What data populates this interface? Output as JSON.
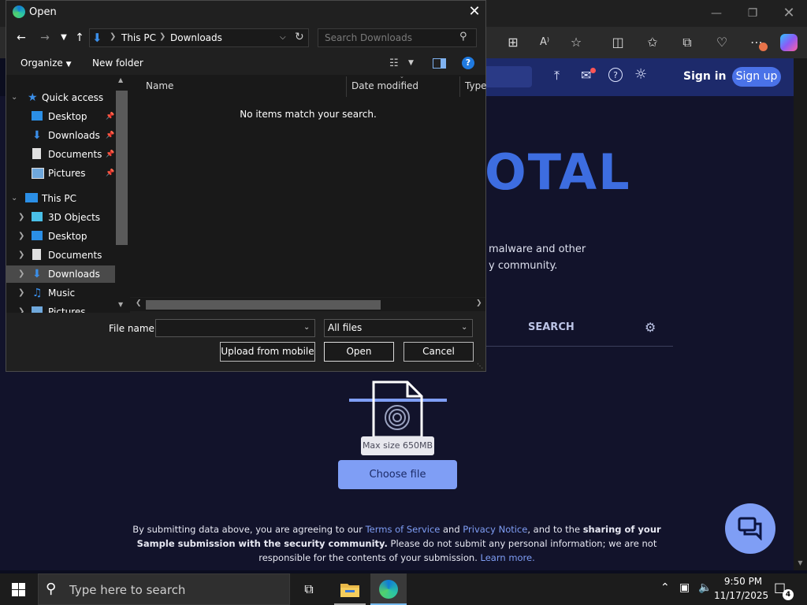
{
  "dialog": {
    "title": "Open",
    "address": {
      "this_pc": "This PC",
      "downloads": "Downloads"
    },
    "search_placeholder": "Search Downloads",
    "toolbar": {
      "organize": "Organize",
      "new_folder": "New folder"
    },
    "nav": {
      "quick_access": "Quick access",
      "qa_items": [
        "Desktop",
        "Downloads",
        "Documents",
        "Pictures"
      ],
      "this_pc": "This PC",
      "pc_items": [
        "3D Objects",
        "Desktop",
        "Documents",
        "Downloads",
        "Music",
        "Pictures"
      ]
    },
    "columns": {
      "name": "Name",
      "date_modified": "Date modified",
      "type": "Type"
    },
    "empty_message": "No items match your search.",
    "file_name_label": "File name:",
    "file_name_value": "",
    "file_type": "All files",
    "buttons": {
      "upload_mobile": "Upload from mobile",
      "open": "Open",
      "cancel": "Cancel"
    }
  },
  "browser": {
    "header": {
      "sign_in": "Sign in",
      "sign_up": "Sign up"
    },
    "page": {
      "logo_fragment": "OTAL",
      "desc_line1": "malware and other",
      "desc_line2": "y community.",
      "tab_search": "SEARCH",
      "tooltip": "Max size 650MB",
      "choose_file": "Choose file",
      "terms": {
        "t1": "By submitting data above, you are agreeing to our ",
        "tos": "Terms of Service",
        "and": " and ",
        "privacy": "Privacy Notice",
        "t2": ", and to the ",
        "sharing": "sharing of your",
        "sample": "Sample submission with the security community.",
        "t3": " Please do not submit any personal information; we are not",
        "t4": "responsible for the contents of your submission. ",
        "learn": "Learn more."
      }
    }
  },
  "taskbar": {
    "search_placeholder": "Type here to search",
    "time": "9:50 PM",
    "date": "11/17/2025",
    "notification_count": "4"
  },
  "colors": {
    "accent": "#7f9ef5",
    "vt_header": "#1d2a6b",
    "vt_logo": "#3d6de0",
    "page_bg": "#12132b"
  }
}
